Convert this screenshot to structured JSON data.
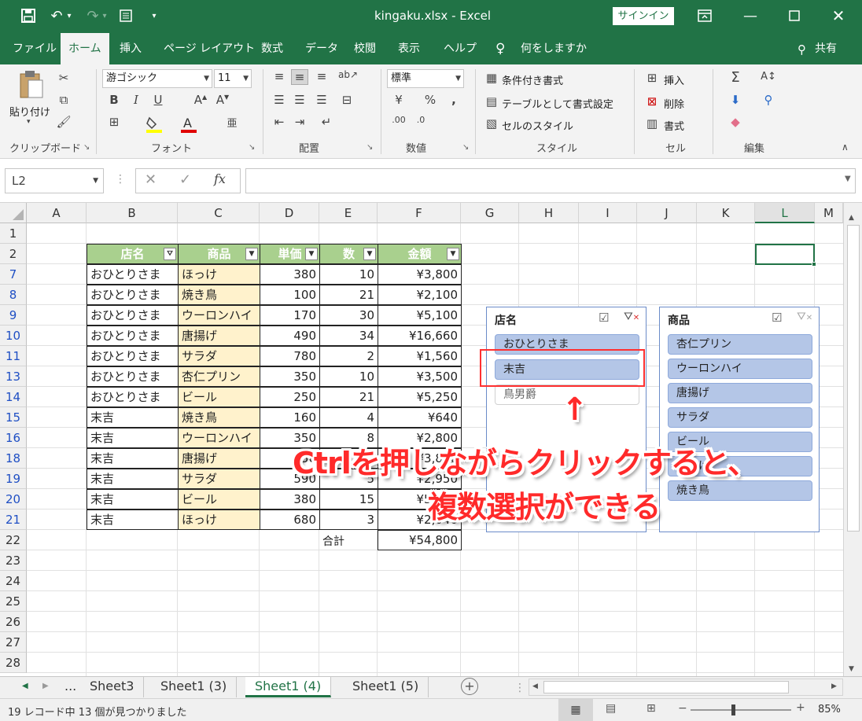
{
  "window": {
    "title": "kingaku.xlsx  -  Excel",
    "signin": "サインイン",
    "accent": "#217346"
  },
  "tabs": [
    "ファイル",
    "ホーム",
    "挿入",
    "ページ レイアウト",
    "数式",
    "データ",
    "校閲",
    "表示",
    "ヘルプ",
    "何をしますか"
  ],
  "share": "共有",
  "ribbon": {
    "clipboard": {
      "paste": "貼り付け",
      "label": "クリップボード"
    },
    "font": {
      "name": "游ゴシック",
      "size": "11",
      "label": "フォント"
    },
    "align": {
      "label": "配置"
    },
    "number": {
      "format": "標準",
      "label": "数値"
    },
    "styles": {
      "cond": "条件付き書式",
      "table": "テーブルとして書式設定",
      "cell": "セルのスタイル",
      "label": "スタイル"
    },
    "cells": {
      "insert": "挿入",
      "delete": "削除",
      "format": "書式",
      "label": "セル"
    },
    "edit": {
      "label": "編集"
    }
  },
  "formula": {
    "namebox": "L2",
    "fx": "fx",
    "value": ""
  },
  "columns": [
    "A",
    "B",
    "C",
    "D",
    "E",
    "F",
    "G",
    "H",
    "I",
    "J",
    "K",
    "L",
    "M"
  ],
  "rows": [
    "1",
    "2",
    "7",
    "8",
    "9",
    "10",
    "11",
    "13",
    "14",
    "15",
    "16",
    "18",
    "19",
    "20",
    "21",
    "22",
    "23",
    "24",
    "25",
    "26",
    "27",
    "28"
  ],
  "table": {
    "headers": [
      "店名",
      "商品",
      "単価",
      "数",
      "金額"
    ],
    "rows": [
      [
        "おひとりさま",
        "ほっけ",
        "380",
        "10",
        "¥3,800"
      ],
      [
        "おひとりさま",
        "焼き鳥",
        "100",
        "21",
        "¥2,100"
      ],
      [
        "おひとりさま",
        "ウーロンハイ",
        "170",
        "30",
        "¥5,100"
      ],
      [
        "おひとりさま",
        "唐揚げ",
        "490",
        "34",
        "¥16,660"
      ],
      [
        "おひとりさま",
        "サラダ",
        "780",
        "2",
        "¥1,560"
      ],
      [
        "おひとりさま",
        "杏仁プリン",
        "350",
        "10",
        "¥3,500"
      ],
      [
        "おひとりさま",
        "ビール",
        "250",
        "21",
        "¥5,250"
      ],
      [
        "末吉",
        "焼き鳥",
        "160",
        "4",
        "¥640"
      ],
      [
        "末吉",
        "ウーロンハイ",
        "350",
        "8",
        "¥2,800"
      ],
      [
        "末吉",
        "唐揚げ",
        "550",
        "",
        "¥3,850"
      ],
      [
        "末吉",
        "サラダ",
        "590",
        "5",
        "¥2,950"
      ],
      [
        "末吉",
        "ビール",
        "380",
        "15",
        "¥5,700"
      ],
      [
        "末吉",
        "ほっけ",
        "680",
        "3",
        "¥2,040"
      ]
    ],
    "total_label": "合計",
    "total_value": "¥54,800"
  },
  "slicer1": {
    "title": "店名",
    "items": [
      "おひとりさま",
      "末吉",
      "鳥男爵"
    ],
    "selected": [
      true,
      true,
      false
    ]
  },
  "slicer2": {
    "title": "商品",
    "items": [
      "杏仁プリン",
      "ウーロンハイ",
      "唐揚げ",
      "サラダ",
      "ビール",
      "ほっけ",
      "焼き鳥"
    ]
  },
  "annotation": {
    "arrow": "↑",
    "line1": "Ctrlを押しながらクリックすると、",
    "line2": "複数選択ができる"
  },
  "sheets": [
    "...",
    "Sheet3",
    "Sheet1 (3)",
    "Sheet1 (4)",
    "Sheet1 (5)"
  ],
  "active_sheet": "Sheet1 (4)",
  "status": {
    "text": "19 レコード中 13 個が見つかりました",
    "zoom": "85%"
  }
}
